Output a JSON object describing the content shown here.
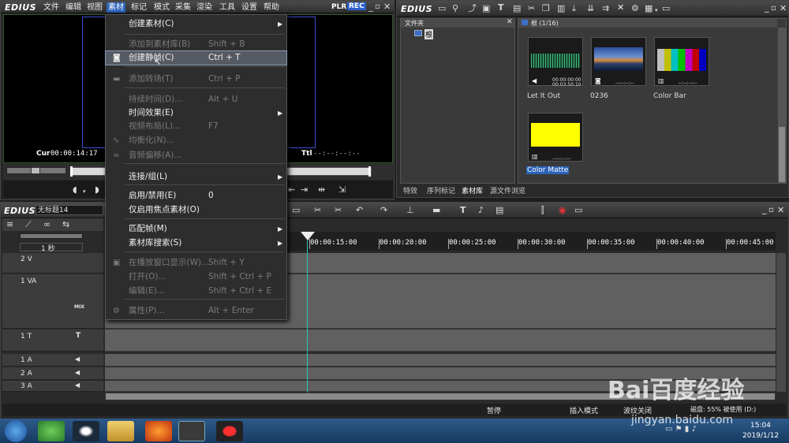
{
  "player": {
    "brand": "EDIUS",
    "menu": [
      "文件",
      "编辑",
      "视图",
      "素材",
      "标记",
      "模式",
      "采集",
      "渲染",
      "工具",
      "设置",
      "帮助"
    ],
    "active_menu": "素材",
    "plr_label": "PLR",
    "rec_label": "REC",
    "cur_label": "Cur",
    "cur_time": "00:00:14:17",
    "ttl_label": "Ttl",
    "ttl_time": "--:--:--:--"
  },
  "dropdown": {
    "items": [
      {
        "label": "创建素材(C)",
        "shortcut": "",
        "submenu": true,
        "disabled": false,
        "icon": ""
      },
      {
        "label": "添加到素材库(B)",
        "shortcut": "Shift + B",
        "submenu": false,
        "disabled": true,
        "icon": ""
      },
      {
        "label": "创建静帧(C)",
        "shortcut": "Ctrl + T",
        "submenu": false,
        "disabled": false,
        "icon": "camera-icon"
      },
      {
        "label": "添加转场(T)",
        "shortcut": "Ctrl + P",
        "submenu": false,
        "disabled": true,
        "icon": "transition-icon"
      },
      {
        "label": "持续时间(D)...",
        "shortcut": "Alt + U",
        "submenu": false,
        "disabled": true,
        "icon": ""
      },
      {
        "label": "时间效果(E)",
        "shortcut": "",
        "submenu": true,
        "disabled": false,
        "icon": ""
      },
      {
        "label": "视频布局(L)...",
        "shortcut": "F7",
        "submenu": false,
        "disabled": true,
        "icon": ""
      },
      {
        "label": "均衡化(N)...",
        "shortcut": "",
        "submenu": false,
        "disabled": true,
        "icon": "waveform-icon"
      },
      {
        "label": "音频偏移(A)...",
        "shortcut": "",
        "submenu": false,
        "disabled": true,
        "icon": "audio-offset-icon"
      },
      {
        "label": "连接/组(L)",
        "shortcut": "",
        "submenu": true,
        "disabled": false,
        "icon": ""
      },
      {
        "label": "启用/禁用(E)",
        "shortcut": "0",
        "submenu": false,
        "disabled": false,
        "icon": ""
      },
      {
        "label": "仅启用焦点素材(O)",
        "shortcut": "",
        "submenu": false,
        "disabled": false,
        "icon": ""
      },
      {
        "label": "匹配帧(M)",
        "shortcut": "",
        "submenu": true,
        "disabled": false,
        "icon": ""
      },
      {
        "label": "素材库搜索(S)",
        "shortcut": "",
        "submenu": true,
        "disabled": false,
        "icon": ""
      },
      {
        "label": "在播放窗口显示(W)...",
        "shortcut": "Shift + Y",
        "submenu": false,
        "disabled": true,
        "icon": "player-icon"
      },
      {
        "label": "打开(O)...",
        "shortcut": "Shift + Ctrl + P",
        "submenu": false,
        "disabled": true,
        "icon": ""
      },
      {
        "label": "编辑(E)...",
        "shortcut": "Shift + Ctrl + E",
        "submenu": false,
        "disabled": true,
        "icon": ""
      },
      {
        "label": "属性(P)...",
        "shortcut": "Alt + Enter",
        "submenu": false,
        "disabled": true,
        "icon": "properties-icon"
      }
    ]
  },
  "bin": {
    "brand": "EDIUS",
    "folder_header": "文件夹",
    "root_folder": "根",
    "path_label": "根 (1/16)",
    "clips": [
      {
        "name": "Let It Out",
        "tc1": "00:00:00:00",
        "tc2": "00:03:50:10"
      },
      {
        "name": "0236",
        "tc1": "",
        "tc2": "--:--:--:--"
      },
      {
        "name": "Color Bar",
        "tc1": "",
        "tc2": "--:--:--:--"
      },
      {
        "name": "Color Matte",
        "tc1": "",
        "tc2": "--:--:--:--"
      }
    ],
    "tabs": [
      "特效",
      "序列标记",
      "素材库",
      "源文件浏览"
    ],
    "active_tab": "素材库"
  },
  "timeline": {
    "brand": "EDIUS",
    "sequence_name": "无标题14",
    "zoom_label": "1 秒",
    "tracks": [
      "2 V",
      "1 VA",
      "1 T",
      "1 A",
      "2 A",
      "3 A"
    ],
    "mix_label": "MIX",
    "ruler": [
      "00:00:15:00",
      "00:00:20:00",
      "00:00:25:00",
      "00:00:30:00",
      "00:00:35:00",
      "00:00:40:00",
      "00:00:45:00"
    ]
  },
  "status": {
    "pause": "暂停",
    "insert_mode": "插入模式",
    "ripple": "波纹关闭",
    "disk": "磁盘: 55% 被使用 (D:)"
  },
  "taskbar": {
    "time": "15:04",
    "date": "2019/1/12"
  },
  "watermark": {
    "brand": "Bai百度经验",
    "url": "jingyan.baidu.com"
  },
  "colors": {
    "accent": "#2b63b8",
    "matte": "#ffff00",
    "playhead": "#29c8a8"
  }
}
